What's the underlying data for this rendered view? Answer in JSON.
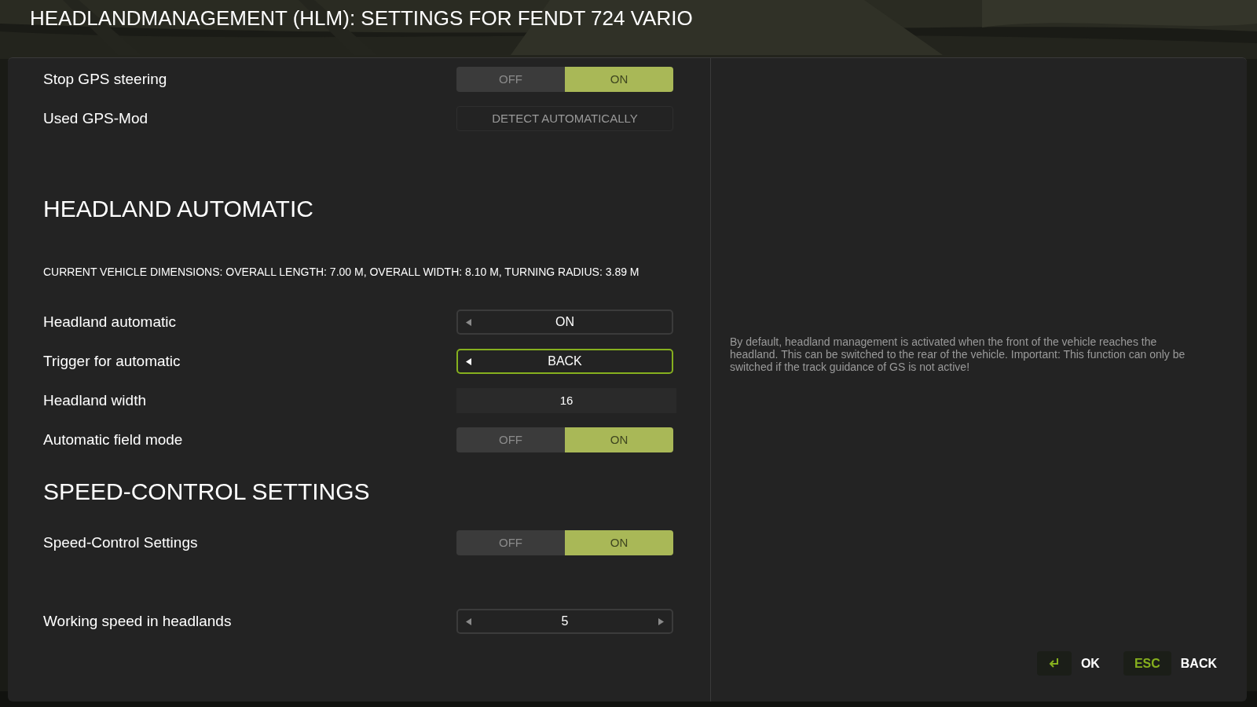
{
  "title": "HEADLANDMANAGEMENT (HLM): SETTINGS FOR FENDT 724 VARIO",
  "sections": [
    {
      "items": [
        {
          "kind": "toggle",
          "label": "Stop GPS steering",
          "options": [
            {
              "text": "OFF",
              "selected": false
            },
            {
              "text": "ON",
              "selected": true
            }
          ]
        },
        {
          "kind": "button",
          "label": "Used GPS-Mod",
          "value": "DETECT AUTOMATICALLY"
        }
      ]
    },
    {
      "heading": "HEADLAND AUTOMATIC",
      "note": "CURRENT VEHICLE DIMENSIONS: OVERALL LENGTH: 7.00 M, OVERALL WIDTH: 8.10 M, TURNING RADIUS: 3.89 M",
      "items": [
        {
          "kind": "selector",
          "label": "Headland automatic",
          "value": "ON",
          "left_arrow": true,
          "right_arrow": false,
          "focused": false
        },
        {
          "kind": "selector",
          "label": "Trigger for automatic",
          "value": "BACK",
          "left_arrow": true,
          "right_arrow": false,
          "focused": true
        },
        {
          "kind": "number",
          "label": "Headland width",
          "value": "16"
        },
        {
          "kind": "toggle",
          "label": "Automatic field mode",
          "options": [
            {
              "text": "OFF",
              "selected": false
            },
            {
              "text": "ON",
              "selected": true
            }
          ]
        }
      ]
    },
    {
      "heading": "SPEED-CONTROL SETTINGS",
      "items": [
        {
          "kind": "toggle",
          "label": "Speed-Control Settings",
          "options": [
            {
              "text": "OFF",
              "selected": false
            },
            {
              "text": "ON",
              "selected": true
            }
          ]
        },
        {
          "kind": "selector",
          "label": "Working speed in headlands",
          "value": "5",
          "left_arrow": true,
          "right_arrow": true,
          "focused": false
        }
      ]
    }
  ],
  "description": "By default, headland management is activated when the front of the vehicle reaches the headland. This can be switched to the rear of the vehicle. Important: This function can only be switched if the track guidance of GS is not active!",
  "footer": [
    {
      "kind": "enter",
      "label": "OK"
    },
    {
      "kind": "key",
      "key": "ESC",
      "label": "BACK"
    }
  ]
}
